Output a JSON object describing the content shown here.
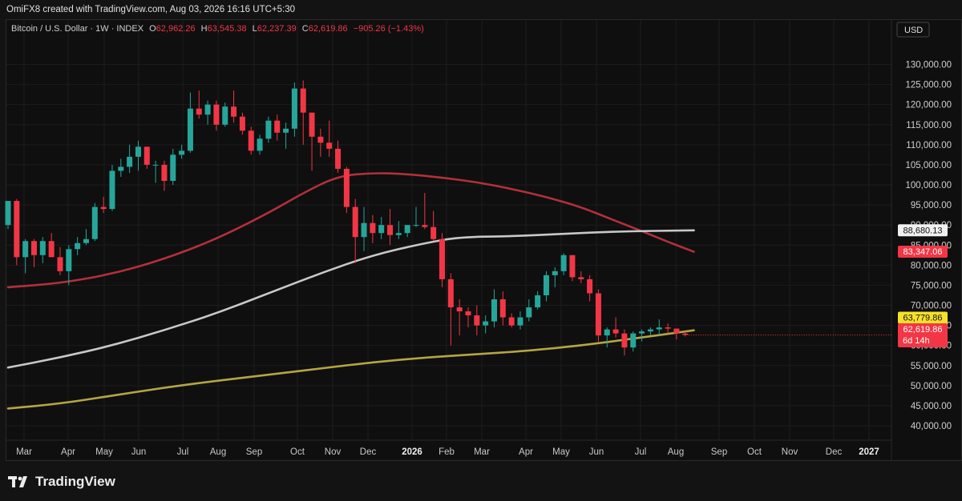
{
  "header": {
    "text": "OmiFX8 created with TradingView.com, Aug 03, 2026 16:16 UTC+5:30"
  },
  "legend": {
    "symbol": "Bitcoin / U.S. Dollar · 1W · INDEX",
    "open_key": "O",
    "open": "62,962.26",
    "high_key": "H",
    "high": "63,545.38",
    "low_key": "L",
    "low": "62,237.39",
    "close_key": "C",
    "close": "62,619.86",
    "change": "−905.26 (−1.43%)"
  },
  "footer": {
    "brand": "TradingView"
  },
  "colors": {
    "up": "#26a69a",
    "down": "#f23645",
    "ma_red": "#b2303a",
    "ma_white": "#c8c8c8",
    "ma_yellow": "#b5a642",
    "background": "#131313"
  },
  "chart_data": {
    "type": "candlestick",
    "currency_label": "USD",
    "y_ticks": [
      {
        "value": 130000,
        "label": "130,000.00"
      },
      {
        "value": 125000,
        "label": "125,000.00"
      },
      {
        "value": 120000,
        "label": "120,000.00"
      },
      {
        "value": 115000,
        "label": "115,000.00"
      },
      {
        "value": 110000,
        "label": "110,000.00"
      },
      {
        "value": 105000,
        "label": "105,000.00"
      },
      {
        "value": 100000,
        "label": "100,000.00"
      },
      {
        "value": 95000,
        "label": "95,000.00"
      },
      {
        "value": 90000,
        "label": "90,000.00"
      },
      {
        "value": 85000,
        "label": "85,000.00"
      },
      {
        "value": 80000,
        "label": "80,000.00"
      },
      {
        "value": 75000,
        "label": "75,000.00"
      },
      {
        "value": 70000,
        "label": "70,000.00"
      },
      {
        "value": 65000,
        "label": "65,000.00"
      },
      {
        "value": 60000,
        "label": "60,000.00"
      },
      {
        "value": 55000,
        "label": "55,000.00"
      },
      {
        "value": 50000,
        "label": "50,000.00"
      },
      {
        "value": 45000,
        "label": "45,000.00"
      },
      {
        "value": 40000,
        "label": "40,000.00"
      }
    ],
    "x_ticks": [
      "Mar",
      "Apr",
      "May",
      "Jun",
      "Jul",
      "Aug",
      "Sep",
      "Oct",
      "Nov",
      "Dec",
      "2026",
      "Feb",
      "Mar",
      "Apr",
      "May",
      "Jun",
      "Jul",
      "Aug",
      "Sep",
      "Oct",
      "Nov",
      "Dec",
      "2027"
    ],
    "price_labels": [
      {
        "text": "88,680.13",
        "value": 88680.13,
        "style": "white"
      },
      {
        "text": "83,347.06",
        "value": 83347.06,
        "style": "red"
      },
      {
        "text": "63,779.86",
        "value": 63779.86,
        "style": "yellow"
      },
      {
        "text": "62,619.86",
        "value": 62619.86,
        "style": "red"
      }
    ],
    "countdown": "6d 14h",
    "candles": [
      [
        90000,
        95500,
        89000,
        96000
      ],
      [
        96000,
        96500,
        80000,
        82000
      ],
      [
        82000,
        86500,
        78000,
        86000
      ],
      [
        86000,
        86500,
        79500,
        82500
      ],
      [
        82500,
        87000,
        80500,
        86000
      ],
      [
        86000,
        88000,
        82000,
        82000
      ],
      [
        82000,
        84500,
        77500,
        78500
      ],
      [
        78500,
        85000,
        75000,
        84000
      ],
      [
        84000,
        87000,
        82500,
        85500
      ],
      [
        85500,
        89000,
        85000,
        86500
      ],
      [
        86500,
        95500,
        86000,
        94500
      ],
      [
        94500,
        97000,
        93000,
        94000
      ],
      [
        94000,
        105000,
        93500,
        103500
      ],
      [
        103500,
        106500,
        102000,
        104500
      ],
      [
        104500,
        110000,
        103000,
        107000
      ],
      [
        107000,
        111000,
        103500,
        109500
      ],
      [
        109500,
        109500,
        104000,
        105000
      ],
      [
        105000,
        106000,
        100500,
        105000
      ],
      [
        105000,
        106000,
        98500,
        101000
      ],
      [
        101000,
        109000,
        100000,
        107500
      ],
      [
        107500,
        110000,
        106500,
        108500
      ],
      [
        108500,
        123000,
        108000,
        119000
      ],
      [
        119000,
        123500,
        116500,
        117500
      ],
      [
        117500,
        121000,
        115000,
        120000
      ],
      [
        120000,
        121000,
        113500,
        115000
      ],
      [
        115000,
        120500,
        114500,
        119500
      ],
      [
        119500,
        123500,
        115500,
        117000
      ],
      [
        117000,
        118000,
        112500,
        113500
      ],
      [
        113500,
        114500,
        107500,
        108500
      ],
      [
        108500,
        112500,
        107500,
        111500
      ],
      [
        111500,
        117000,
        110500,
        116000
      ],
      [
        116000,
        117500,
        111000,
        113000
      ],
      [
        113000,
        115500,
        109000,
        114000
      ],
      [
        114000,
        125500,
        112000,
        124000
      ],
      [
        124000,
        126000,
        110000,
        118000
      ],
      [
        118000,
        118000,
        103500,
        112000
      ],
      [
        112000,
        114000,
        107000,
        110500
      ],
      [
        110500,
        116000,
        107000,
        109000
      ],
      [
        109000,
        111000,
        103000,
        104000
      ],
      [
        104000,
        104500,
        93000,
        94500
      ],
      [
        94500,
        96500,
        80500,
        87000
      ],
      [
        87000,
        94500,
        83500,
        90500
      ],
      [
        90500,
        92500,
        85500,
        88000
      ],
      [
        88000,
        92000,
        86500,
        90000
      ],
      [
        90000,
        94000,
        85000,
        87500
      ],
      [
        87500,
        91000,
        86500,
        88000
      ],
      [
        88000,
        90000,
        87000,
        90000
      ],
      [
        90000,
        94500,
        89500,
        90000
      ],
      [
        90000,
        98000,
        89000,
        89500
      ],
      [
        89500,
        93500,
        86000,
        86500
      ],
      [
        86500,
        88000,
        74500,
        76500
      ],
      [
        76500,
        78000,
        60000,
        69500
      ],
      [
        69500,
        71500,
        62500,
        68500
      ],
      [
        68500,
        69500,
        64500,
        67500
      ],
      [
        67500,
        70000,
        62500,
        65000
      ],
      [
        65000,
        67500,
        63000,
        66000
      ],
      [
        66000,
        74000,
        64500,
        71500
      ],
      [
        71500,
        73500,
        65000,
        67000
      ],
      [
        67000,
        68000,
        64500,
        65000
      ],
      [
        65000,
        68500,
        64000,
        67000
      ],
      [
        67000,
        71500,
        66000,
        69500
      ],
      [
        69500,
        73500,
        69000,
        72500
      ],
      [
        72500,
        78500,
        71000,
        77500
      ],
      [
        77500,
        79500,
        74500,
        78500
      ],
      [
        78500,
        83000,
        77500,
        82500
      ],
      [
        82500,
        82500,
        76000,
        77000
      ],
      [
        77000,
        78500,
        75500,
        76500
      ],
      [
        76500,
        77500,
        71000,
        73000
      ],
      [
        73000,
        74000,
        61000,
        62500
      ],
      [
        62500,
        64500,
        59500,
        64000
      ],
      [
        64000,
        67000,
        62000,
        63000
      ],
      [
        63000,
        64000,
        57500,
        59500
      ],
      [
        59500,
        63500,
        58500,
        63000
      ],
      [
        63000,
        64000,
        61000,
        63500
      ],
      [
        63500,
        64500,
        62500,
        64000
      ],
      [
        64000,
        66500,
        62500,
        64500
      ],
      [
        64500,
        65500,
        63000,
        64200
      ],
      [
        64200,
        64200,
        61500,
        63000
      ],
      [
        62962.26,
        63545.38,
        62237.39,
        62619.86
      ]
    ],
    "ma_series": [
      {
        "color_key": "ma_red",
        "points": [
          [
            0,
            74500
          ],
          [
            6,
            75500
          ],
          [
            12,
            77800
          ],
          [
            18,
            81500
          ],
          [
            24,
            86500
          ],
          [
            30,
            93000
          ],
          [
            34,
            98000
          ],
          [
            38,
            102200
          ],
          [
            42,
            103000
          ],
          [
            46,
            102700
          ],
          [
            50,
            101800
          ],
          [
            54,
            100700
          ],
          [
            58,
            99000
          ],
          [
            62,
            97000
          ],
          [
            66,
            94500
          ],
          [
            70,
            91000
          ],
          [
            73,
            88500
          ],
          [
            76,
            85800
          ],
          [
            79,
            83347
          ]
        ]
      },
      {
        "color_key": "ma_white",
        "points": [
          [
            0,
            54500
          ],
          [
            6,
            57000
          ],
          [
            12,
            60000
          ],
          [
            18,
            63800
          ],
          [
            24,
            68000
          ],
          [
            30,
            73000
          ],
          [
            36,
            78000
          ],
          [
            42,
            82500
          ],
          [
            48,
            85500
          ],
          [
            52,
            87000
          ],
          [
            58,
            87200
          ],
          [
            64,
            87800
          ],
          [
            70,
            88400
          ],
          [
            79,
            88680
          ]
        ]
      },
      {
        "color_key": "ma_yellow",
        "points": [
          [
            0,
            44300
          ],
          [
            6,
            45500
          ],
          [
            12,
            47500
          ],
          [
            18,
            49500
          ],
          [
            24,
            51200
          ],
          [
            30,
            52700
          ],
          [
            36,
            54300
          ],
          [
            42,
            55800
          ],
          [
            48,
            57000
          ],
          [
            54,
            57800
          ],
          [
            60,
            58700
          ],
          [
            66,
            60000
          ],
          [
            72,
            61700
          ],
          [
            79,
            63780
          ]
        ]
      }
    ]
  }
}
